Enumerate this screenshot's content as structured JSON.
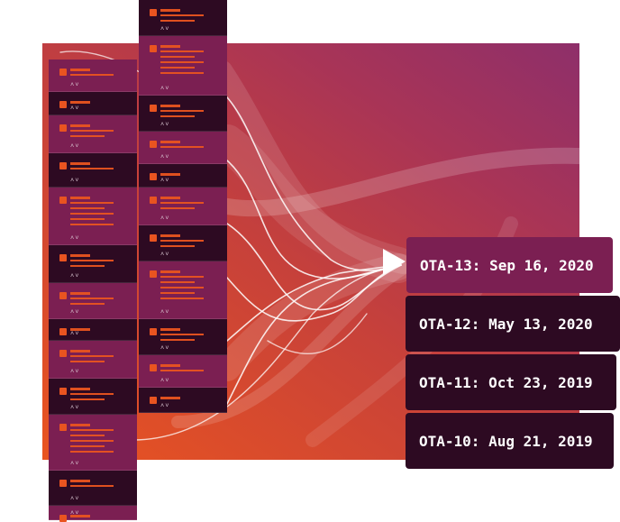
{
  "ota_releases": [
    {
      "label": "OTA-13: Sep 16, 2020",
      "active": true
    },
    {
      "label": "OTA-12: May 13, 2020",
      "active": false
    },
    {
      "label": "OTA-11: Oct 23, 2019",
      "active": false
    },
    {
      "label": "OTA-10: Aug 21, 2019",
      "active": false
    }
  ],
  "colors": {
    "ubuntu_orange": "#e95420",
    "aubergine": "#7b1f52",
    "dark_aubergine": "#2d0a22",
    "text": "#ffffff"
  },
  "icons": [
    "expand-collapse-icon",
    "arrow-right-icon",
    "app-icon"
  ]
}
